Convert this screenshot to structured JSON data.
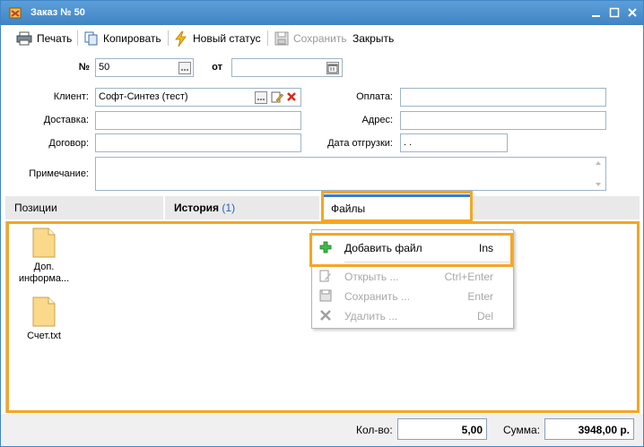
{
  "window": {
    "title": "Заказ № 50"
  },
  "toolbar": {
    "print_label": "Печать",
    "copy_label": "Копировать",
    "status_label": "Новый статус",
    "save_label": "Сохранить",
    "close_label": "Закрыть"
  },
  "form": {
    "number_label": "№",
    "number_value": "50",
    "from_label": "от",
    "from_value": "",
    "client_label": "Клиент:",
    "client_value": "Софт-Синтез (тест)",
    "payment_label": "Оплата:",
    "payment_value": "",
    "delivery_label": "Доставка:",
    "delivery_value": "",
    "address_label": "Адрес:",
    "address_value": "",
    "contract_label": "Договор:",
    "contract_value": "",
    "shipdate_label": "Дата отгрузки:",
    "shipdate_value": " .  .",
    "note_label": "Примечание:",
    "note_value": ""
  },
  "tabs": [
    {
      "label": "Позиции"
    },
    {
      "label": "История",
      "count": "(1)"
    },
    {
      "label": "Файлы",
      "active": true
    }
  ],
  "files": [
    {
      "name": "Доп. информа..."
    },
    {
      "name": "Счет.txt"
    }
  ],
  "context_menu": {
    "items": [
      {
        "label": "Добавить файл",
        "shortcut": "Ins",
        "icon": "plus-icon",
        "enabled": true
      },
      {
        "label": "Открыть ...",
        "shortcut": "Ctrl+Enter",
        "icon": "open-icon",
        "enabled": false
      },
      {
        "label": "Сохранить ...",
        "shortcut": "Enter",
        "icon": "save-icon",
        "enabled": false
      },
      {
        "label": "Удалить ...",
        "shortcut": "Del",
        "icon": "delete-icon",
        "enabled": false
      }
    ]
  },
  "status": {
    "qty_label": "Кол-во:",
    "qty_value": "5,00",
    "sum_label": "Сумма:",
    "sum_value": "3948,00 р."
  },
  "colors": {
    "accent": "#3a7bd0",
    "highlight": "#f5a623",
    "titlebar": "#4a8fce"
  }
}
